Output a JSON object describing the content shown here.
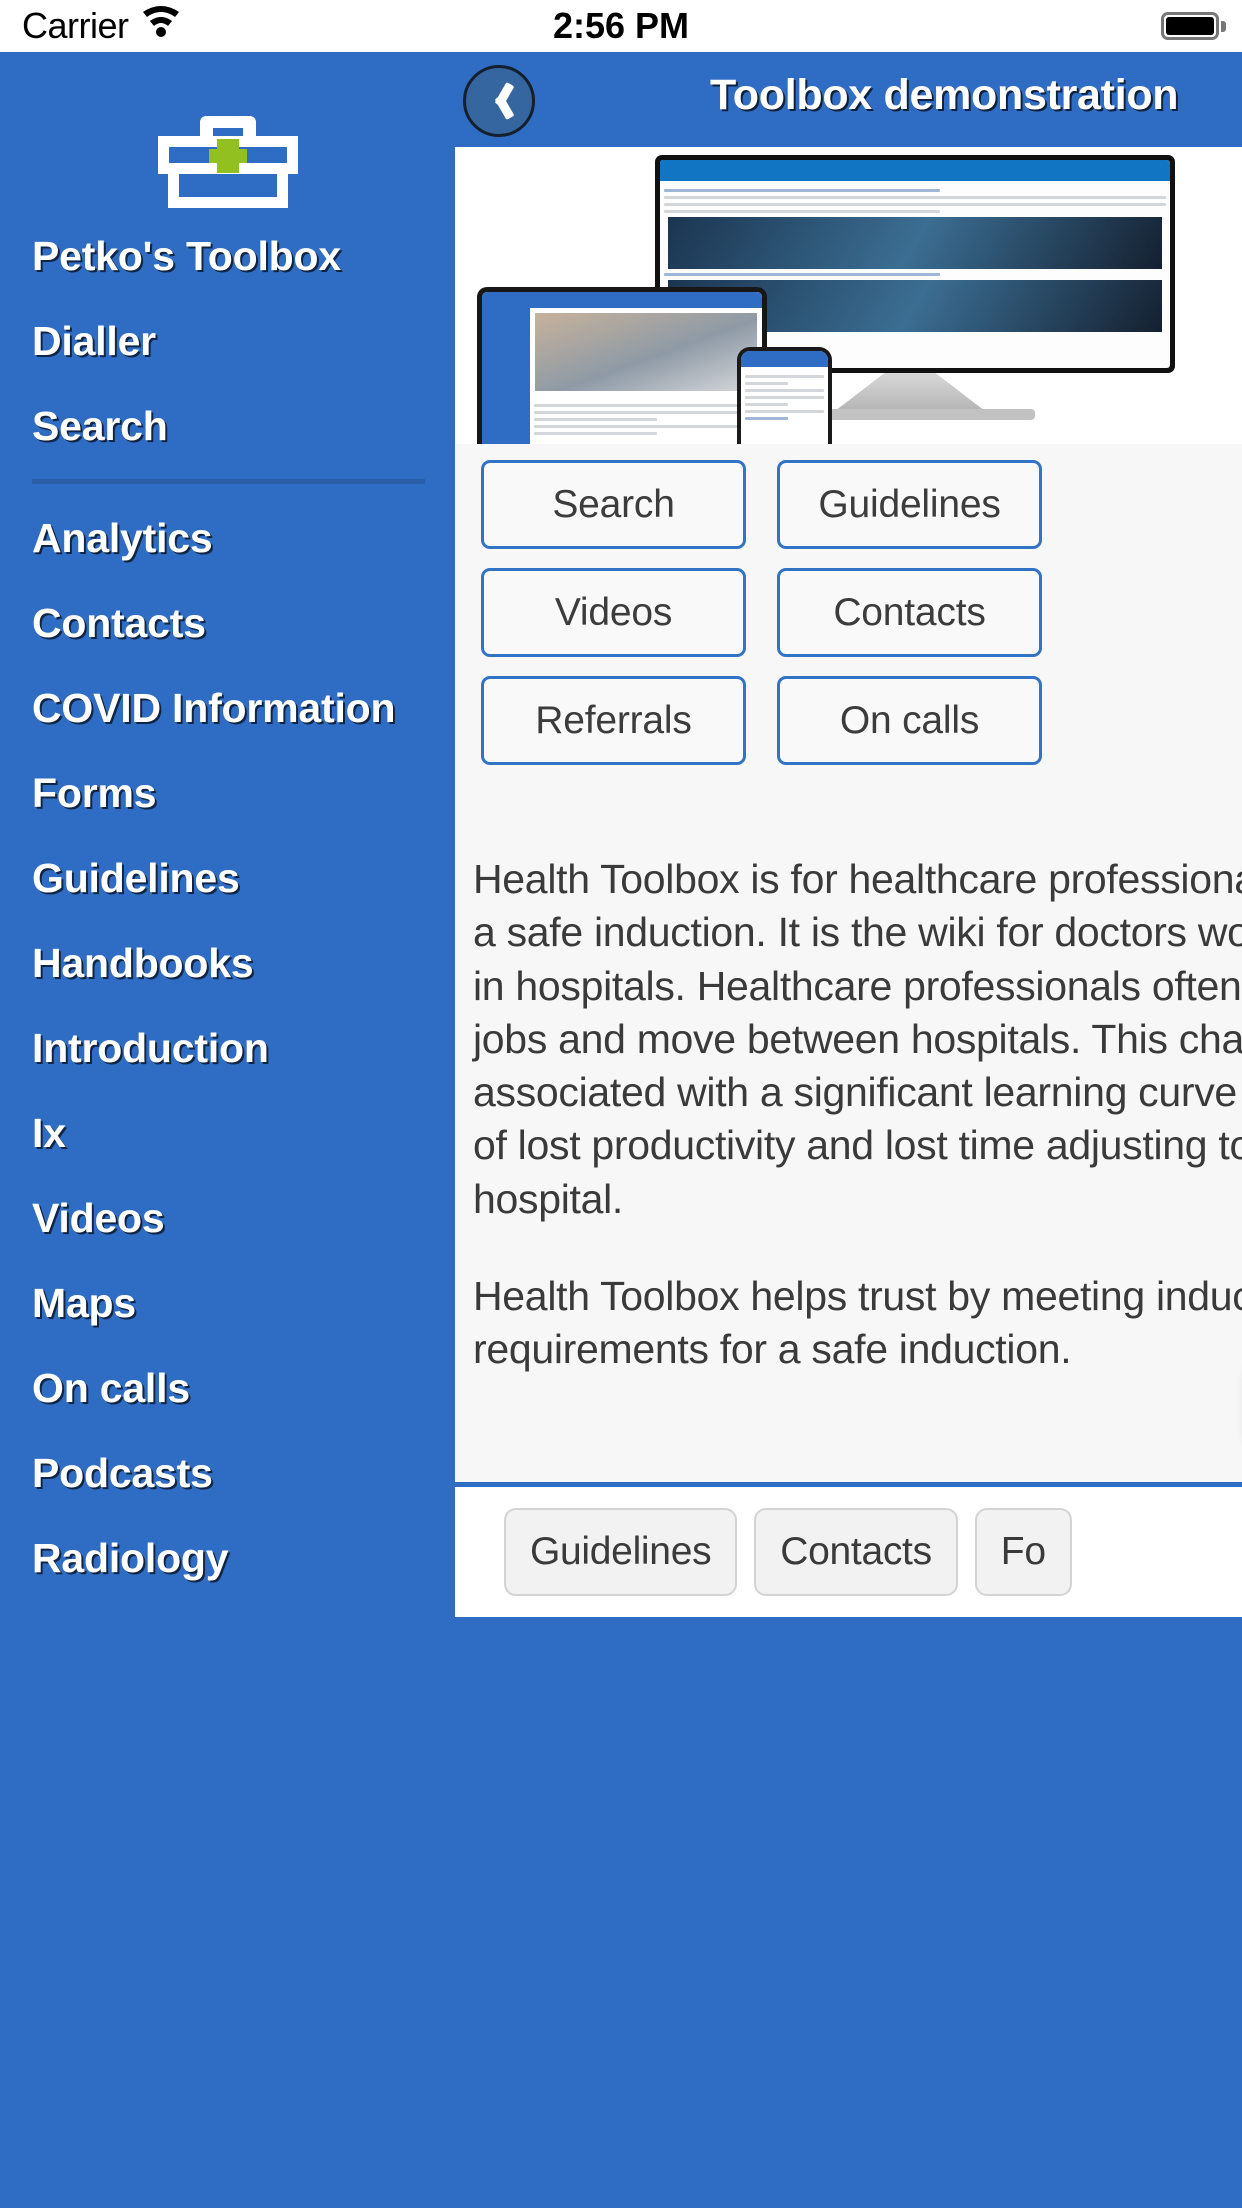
{
  "status_bar": {
    "carrier": "Carrier",
    "wifi_icon": "wifi-icon",
    "time": "2:56 PM",
    "battery_icon": "battery-full-icon"
  },
  "drawer": {
    "logo_icon": "medical-toolbox-icon",
    "logo_colors": {
      "case": "#FFFFFF",
      "cross": "#93C021"
    },
    "background": "#2F6CC4",
    "items": [
      {
        "label": "Petko's Toolbox",
        "separator_after": false
      },
      {
        "label": "Dialler",
        "separator_after": false
      },
      {
        "label": "Search",
        "separator_after": true
      },
      {
        "label": "Analytics",
        "separator_after": false
      },
      {
        "label": "Contacts",
        "separator_after": false
      },
      {
        "label": "COVID Information",
        "separator_after": false
      },
      {
        "label": "Forms",
        "separator_after": false
      },
      {
        "label": "Guidelines",
        "separator_after": false
      },
      {
        "label": "Handbooks",
        "separator_after": false
      },
      {
        "label": "Introduction",
        "separator_after": false
      },
      {
        "label": "Ix",
        "separator_after": false
      },
      {
        "label": "Videos",
        "separator_after": false
      },
      {
        "label": "Maps",
        "separator_after": false
      },
      {
        "label": "On calls",
        "separator_after": false
      },
      {
        "label": "Podcasts",
        "separator_after": false
      },
      {
        "label": "Radiology",
        "separator_after": false
      }
    ]
  },
  "detail": {
    "nav": {
      "back_icon": "chevron-left-icon",
      "title": "Toolbox demonstration"
    },
    "hero": {
      "image_alt": "health-toolbox-devices-promo-image"
    },
    "quick_links": [
      "Search",
      "Guidelines",
      "Videos",
      "Contacts",
      "Referrals",
      "On calls"
    ],
    "article": {
      "paragraphs": [
        "Health Toolbox is for healthcare professionals to get",
        "a safe induction. It is the wiki for doctors working",
        "in hospitals. Healthcare professionals often change",
        "jobs and move between hospitals. This change is",
        "associated with a significant learning curve in terms",
        "of lost productivity and lost time adjusting to a new",
        "hospital."
      ],
      "paragraphs2": [
        "Health Toolbox helps trust by meeting induction",
        "requirements for a safe induction."
      ]
    },
    "edit_fab": {
      "icon": "writing-hand-icon",
      "glyph": "✍️"
    },
    "tab_bar": [
      "Guidelines",
      "Contacts",
      "Fo"
    ]
  },
  "colors": {
    "brand_blue": "#2F6CC4",
    "dark_blue_separator": "#2A5EA8",
    "button_border_blue": "#3173C4",
    "accent_green": "#93C021",
    "panel_background": "#F7F7F7"
  }
}
